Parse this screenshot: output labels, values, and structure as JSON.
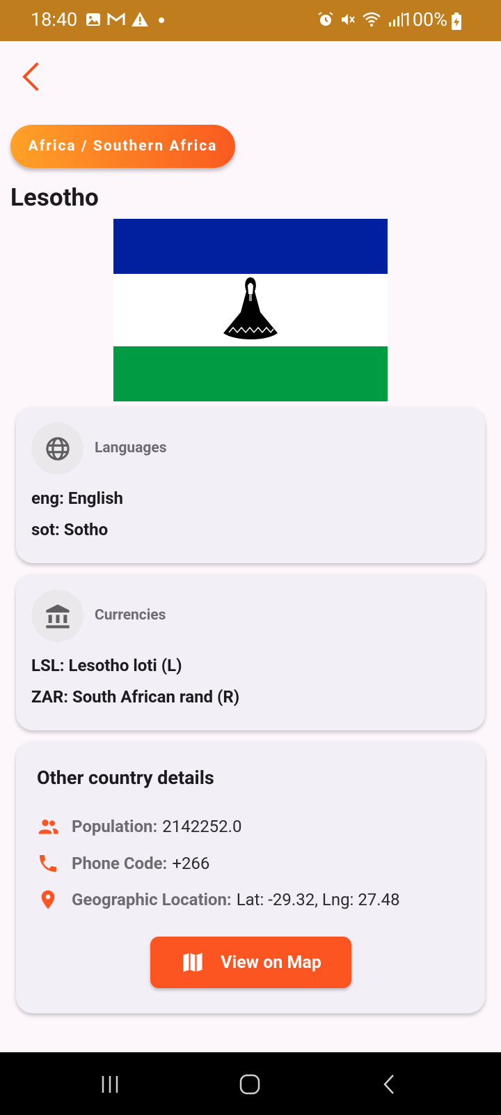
{
  "status_bar": {
    "time": "18:40",
    "battery": "100%",
    "left_icons": [
      "image-icon",
      "gmail-icon",
      "warning-icon",
      "dot-icon"
    ],
    "right_icons": [
      "alarm-icon",
      "mute-icon",
      "wifi-icon",
      "signal-icon",
      "battery-charging-icon"
    ]
  },
  "header": {
    "back_icon": "chevron-left-icon"
  },
  "region": {
    "label": "Africa / Southern Africa"
  },
  "country": {
    "name": "Lesotho"
  },
  "languages": {
    "label": "Languages",
    "icon": "globe-icon",
    "items": [
      "eng: English",
      "sot: Sotho"
    ]
  },
  "currencies": {
    "label": "Currencies",
    "icon": "bank-icon",
    "items": [
      "LSL: Lesotho loti (L)",
      "ZAR: South African rand (R)"
    ]
  },
  "details": {
    "title": "Other country details",
    "population_label": "Population:",
    "population_value": "2142252.0",
    "phone_label": "Phone Code:",
    "phone_value": "+266",
    "geo_label": "Geographic Location:",
    "geo_value": "Lat: -29.32, Lng: 27.48",
    "map_button": "View on Map"
  },
  "colors": {
    "accent": "#fc5521",
    "status_bar": "#bf7d1d",
    "flag_blue": "#00209f",
    "flag_green": "#009b42"
  }
}
